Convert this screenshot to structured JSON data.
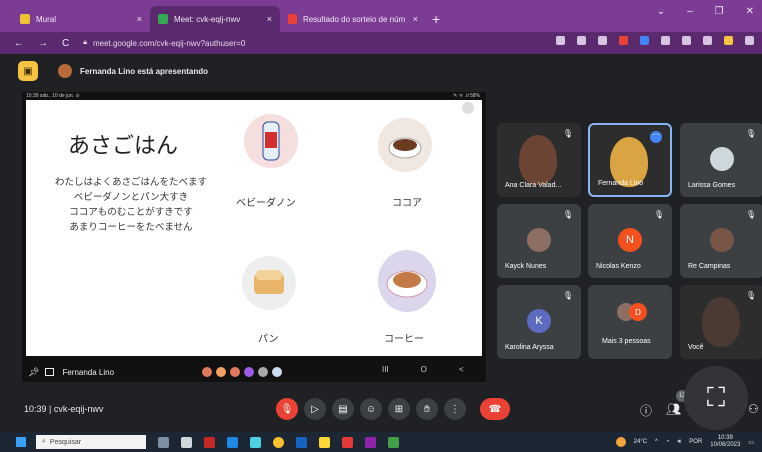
{
  "browser": {
    "tabs": [
      {
        "label": "Mural",
        "active": false,
        "favicon_color": "#f1c232"
      },
      {
        "label": "Meet: cvk-eqij-nwv",
        "active": true,
        "favicon_color": "#34a853"
      },
      {
        "label": "Resultado do sorteio de número",
        "active": false,
        "favicon_color": "#ea4335"
      }
    ],
    "close_glyph": "×",
    "new_tab_glyph": "+",
    "url": "meet.google.com/cvk-eqij-nwv?authuser=0"
  },
  "presentation_bar": {
    "text": "Fernanda Lino está apresentando"
  },
  "slide": {
    "status_left": "10:39  sáb., 10 de jun.  ⊙",
    "status_right": "✎ ᯤ .ıl 58%",
    "title": "あさごはん",
    "lines": [
      "わたしはよくあさごはんをたべます",
      "ベビーダノンとパン大すき",
      "ココアものむことがすきです",
      "あまりコーヒーをたべません"
    ],
    "foods": [
      {
        "label": "ベビーダノン",
        "icon": "yogurt-icon"
      },
      {
        "label": "ココア",
        "icon": "cocoa-icon"
      },
      {
        "label": "パン",
        "icon": "bread-icon"
      },
      {
        "label": "コーヒー",
        "icon": "coffee-icon"
      }
    ]
  },
  "stage_footer": {
    "presenter": "Fernanda Lino",
    "nav": [
      "III",
      "O",
      "<"
    ]
  },
  "participants": [
    {
      "name": "Ana Clara Valad...",
      "type": "video",
      "color": "#1f2a30"
    },
    {
      "name": "Fernanda Lino",
      "type": "video",
      "color": "#6a6a2a",
      "active": true
    },
    {
      "name": "Larissa Gomes",
      "type": "avatar",
      "color": "#cfd8dc"
    },
    {
      "name": "Kayck Nunes",
      "type": "avatar",
      "color": "#8d6e63"
    },
    {
      "name": "Nicolas Kenzo",
      "type": "initial",
      "initial": "N",
      "color": "#f4511e"
    },
    {
      "name": "Re Campinas",
      "type": "avatar",
      "color": "#795548"
    },
    {
      "name": "Karolina Aryssa",
      "type": "initial",
      "initial": "K",
      "color": "#5c6bc0"
    },
    {
      "name": "Mais 3 pessoas",
      "type": "more",
      "color": "#5f6368"
    },
    {
      "name": "Você",
      "type": "video",
      "color": "#3e3530"
    }
  ],
  "meeting": {
    "time": "10:39",
    "code": "cvk-eqij-nwv",
    "participant_count": "12"
  },
  "taskbar": {
    "search_placeholder": "Pesquisar",
    "temperature": "24°C",
    "language": "POR",
    "time": "10:39",
    "date": "10/06/2023"
  },
  "colors": {
    "accent_red": "#ea4335",
    "chrome_purple": "#7c3c93"
  }
}
